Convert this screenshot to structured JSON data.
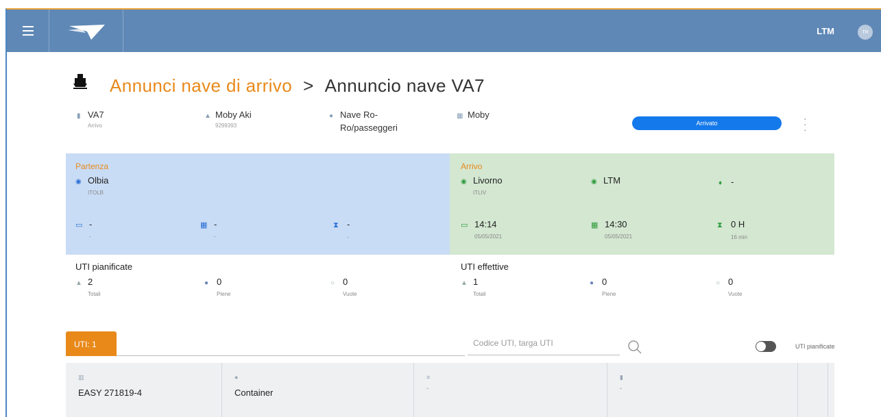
{
  "topbar": {
    "user": "LTM",
    "avatar_initials": "TR",
    "menu_icon": "hamburger-icon",
    "logo_icon": "arrow-logo-icon"
  },
  "breadcrumb": {
    "parent": "Annunci nave di arrivo",
    "separator": ">",
    "current": "Annuncio nave VA7"
  },
  "header": {
    "code": "VA7",
    "code_sub": "Arrivo",
    "ship_name": "Moby Aki",
    "ship_id": "9299393",
    "ship_type_line1": "Nave Ro-",
    "ship_type_line2": "Ro/passeggeri",
    "company": "Moby",
    "status": "Arrivato"
  },
  "departure": {
    "label": "Partenza",
    "port": "Olbia",
    "port_code": "ITOLB",
    "date1": "-",
    "date1_sub": "-",
    "date2": "-",
    "date2_sub": "-",
    "duration": "-",
    "duration_sub": "-"
  },
  "arrival": {
    "label": "Arrivo",
    "port": "Livorno",
    "port_code": "ITLIV",
    "terminal": "LTM",
    "berth": "-",
    "date1": "14:14",
    "date1_sub": "05/05/2021",
    "date2": "14:30",
    "date2_sub": "05/05/2021",
    "duration": "0 H",
    "duration_sub": "16 min"
  },
  "uti_planned": {
    "title": "UTI pianificate",
    "total": "2",
    "total_label": "Totali",
    "full": "0",
    "full_label": "Piene",
    "empty": "0",
    "empty_label": "Vuote"
  },
  "uti_actual": {
    "title": "UTI effettive",
    "total": "1",
    "total_label": "Totali",
    "full": "0",
    "full_label": "Piene",
    "empty": "0",
    "empty_label": "Vuote"
  },
  "tabs": {
    "uti_tab": "UTI: 1"
  },
  "search": {
    "placeholder": "Codice UTI, targa UTI"
  },
  "toggle": {
    "label": "UTI pianificate"
  },
  "table": {
    "row": {
      "code": "EASY 271819-4",
      "type": "Container",
      "col3": "-",
      "col4": "-"
    }
  },
  "colors": {
    "topbar": "#5f88b6",
    "accent_orange": "#e8891a",
    "status_blue": "#1479ea",
    "departure_bg": "#c9dcf5",
    "arrival_bg": "#d3e7d1"
  }
}
